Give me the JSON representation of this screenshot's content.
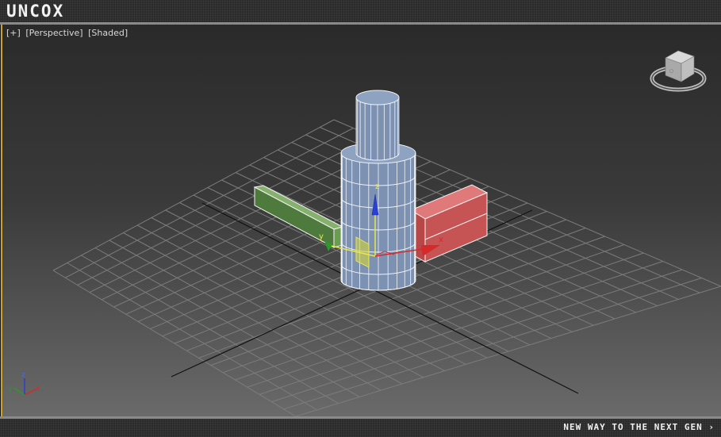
{
  "app": {
    "logo": "uncox"
  },
  "viewport": {
    "labels": [
      "[+]",
      "[Perspective]",
      "[Shaded]"
    ]
  },
  "gizmo": {
    "x_label": "x",
    "y_label": "y",
    "z_label": "z"
  },
  "corner_axes": {
    "x_label": "x",
    "y_label": "y",
    "z_label": "z"
  },
  "footer": {
    "tagline": "NEW WAY TO THE NEXT GEN ›"
  },
  "colors": {
    "viewport_border": "#c9a227",
    "cylinder": "#7d92b3",
    "green_box": "#4f7a3d",
    "red_box": "#c75454",
    "axis_x": "#d42a2a",
    "axis_y": "#2a9a2a",
    "axis_z": "#2a3fd4"
  }
}
